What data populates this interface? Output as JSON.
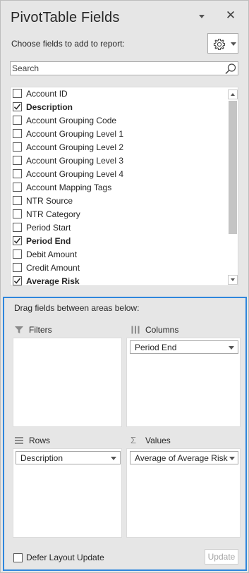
{
  "pane": {
    "title": "PivotTable Fields",
    "close_glyph": "✕",
    "choose_label": "Choose fields to add to report:",
    "settings_icon": "gear-icon"
  },
  "search": {
    "placeholder": "Search",
    "value": ""
  },
  "fields": [
    {
      "label": "Account ID",
      "checked": false
    },
    {
      "label": "Description",
      "checked": true
    },
    {
      "label": "Account Grouping Code",
      "checked": false
    },
    {
      "label": "Account Grouping Level 1",
      "checked": false
    },
    {
      "label": "Account Grouping Level 2",
      "checked": false
    },
    {
      "label": "Account Grouping Level 3",
      "checked": false
    },
    {
      "label": "Account Grouping Level 4",
      "checked": false
    },
    {
      "label": "Account Mapping Tags",
      "checked": false
    },
    {
      "label": "NTR Source",
      "checked": false
    },
    {
      "label": "NTR Category",
      "checked": false
    },
    {
      "label": "Period Start",
      "checked": false
    },
    {
      "label": "Period End",
      "checked": true
    },
    {
      "label": "Debit Amount",
      "checked": false
    },
    {
      "label": "Credit Amount",
      "checked": false
    },
    {
      "label": "Average Risk",
      "checked": true
    }
  ],
  "areas": {
    "drag_label": "Drag fields between areas below:",
    "filters": {
      "label": "Filters",
      "items": []
    },
    "columns": {
      "label": "Columns",
      "items": [
        "Period End"
      ]
    },
    "rows": {
      "label": "Rows",
      "items": [
        "Description"
      ]
    },
    "values": {
      "label": "Values",
      "items": [
        "Average of Average Risk"
      ]
    }
  },
  "footer": {
    "defer_label": "Defer Layout Update",
    "defer_checked": false,
    "update_label": "Update"
  },
  "colors": {
    "pane_bg": "#e6e6e6",
    "focus_border": "#2f86dc",
    "disabled_text": "#a6a6a6"
  }
}
